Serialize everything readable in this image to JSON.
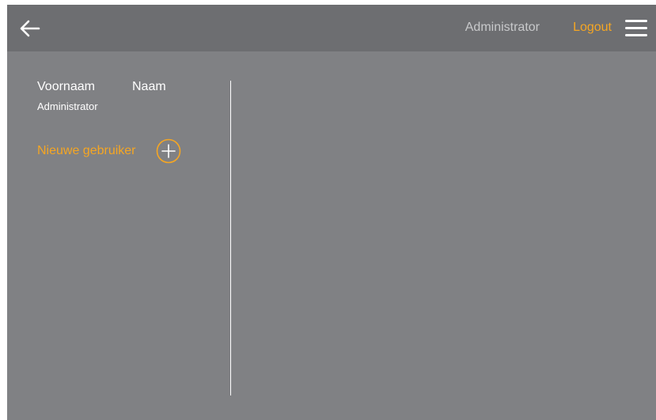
{
  "header": {
    "user_name": "Administrator",
    "logout_label": "Logout"
  },
  "icons": {
    "back": "arrow-left-icon",
    "menu": "hamburger-menu-icon",
    "add": "plus-circle-icon"
  },
  "user_list": {
    "columns": [
      "Voornaam",
      "Naam"
    ],
    "rows": [
      {
        "label": "Administrator"
      }
    ],
    "new_user_label": "Nieuwe gebruiker"
  },
  "colors": {
    "background": "#808184",
    "header": "#6d6e71",
    "accent": "#f5a623",
    "text": "#ffffff"
  }
}
